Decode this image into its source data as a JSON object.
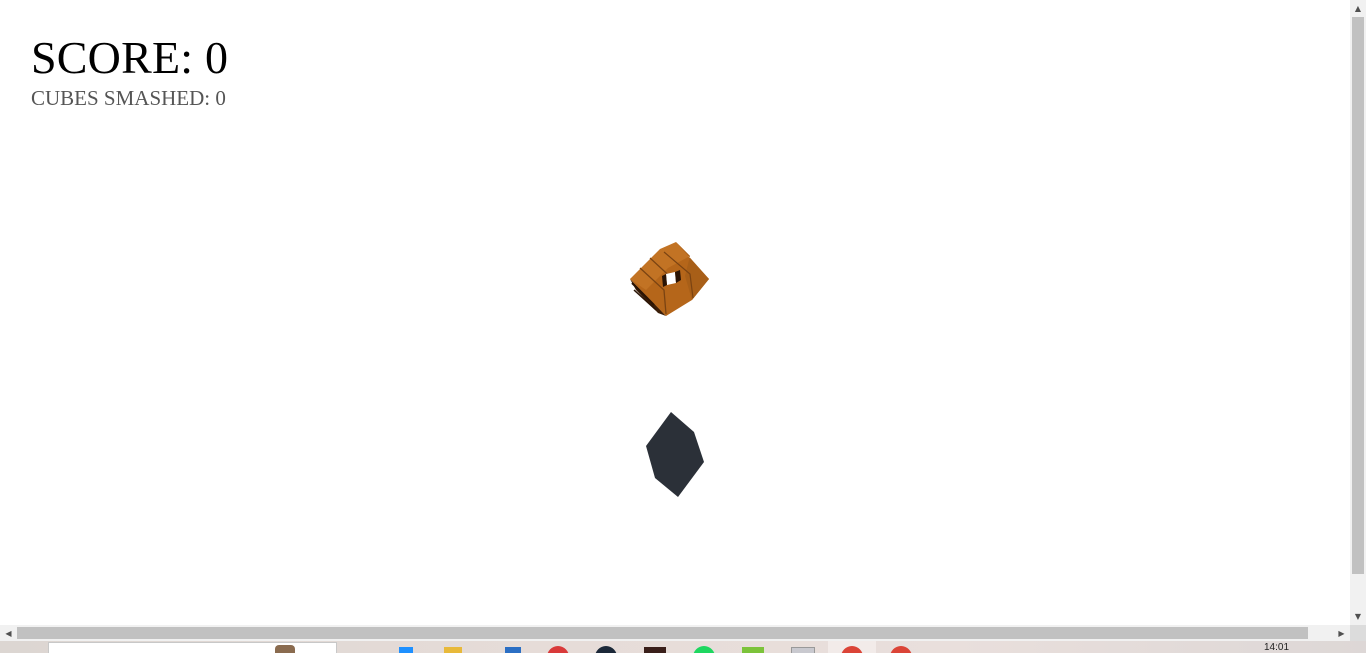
{
  "hud": {
    "score_label": "SCORE: 0",
    "cubes_smashed_label": "CUBES SMASHED: 0"
  },
  "scene": {
    "crate_cube": {
      "name": "crate-cube",
      "colors": {
        "top": "#b5661a",
        "side_light": "#c27324",
        "side_dark": "#6a3a12",
        "edge": "#3b1e08",
        "hole": "#ffffff"
      }
    },
    "player_cube": {
      "name": "player-cube",
      "color": "#2b3038"
    }
  },
  "scrollbars": {
    "up_arrow": "▲",
    "down_arrow": "▼",
    "left_arrow": "◀",
    "right_arrow": "▶"
  },
  "taskbar": {
    "clock": "14:01",
    "icons": [
      "file-icon",
      "folder-icon",
      "store-icon",
      "opera-icon",
      "steam-icon",
      "media-icon",
      "spotify-icon",
      "minecraft-icon",
      "window-icon",
      "chrome-icon",
      "chrome-icon-2"
    ]
  }
}
